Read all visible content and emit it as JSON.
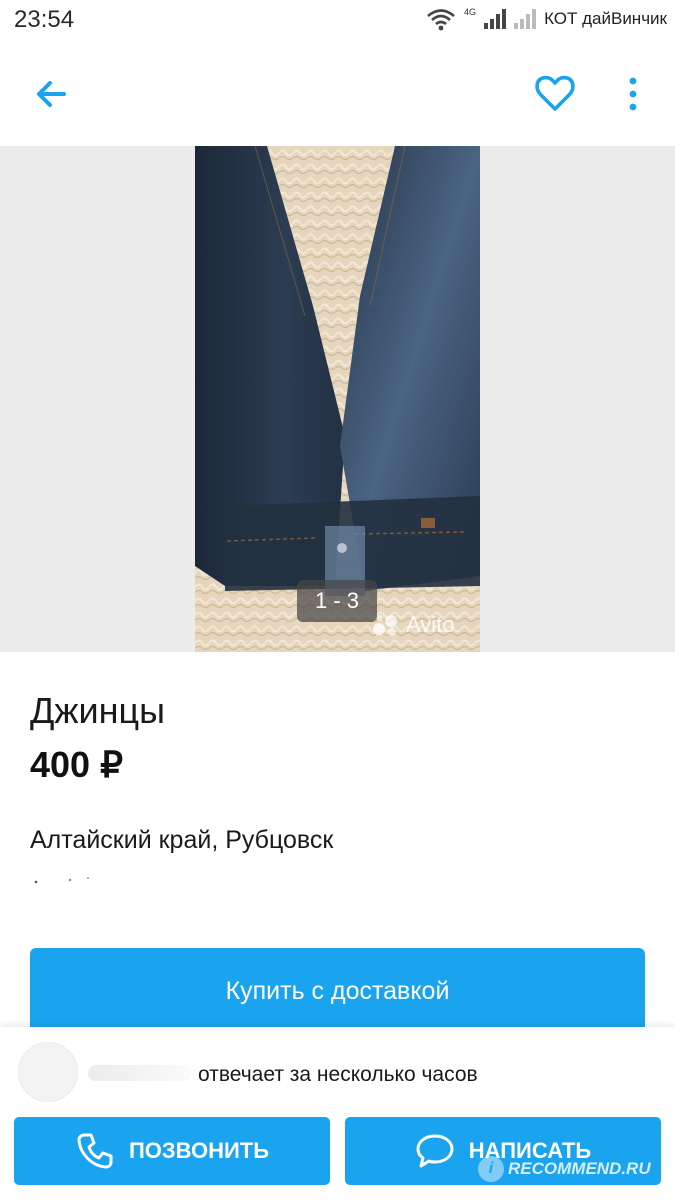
{
  "status_bar": {
    "time": "23:54",
    "network": "4G",
    "carrier": "КОТ дайВинчик"
  },
  "header": {
    "back_icon": "arrow-left-icon",
    "favorite_icon": "heart-outline-icon",
    "more_icon": "more-vertical-icon",
    "accent_color": "#1aa3ee"
  },
  "gallery": {
    "counter": "1 - 3",
    "watermark": "Avito"
  },
  "listing": {
    "title": "Джинцы",
    "price": "400 ₽",
    "location": "Алтайский край, Рубцовск"
  },
  "buy_button": {
    "label": "Купить с доставкой",
    "color": "#1aa3ee"
  },
  "seller": {
    "response_text": "отвечает за несколько часов"
  },
  "actions": {
    "call_label": "ПОЗВОНИТЬ",
    "call_icon": "phone-icon",
    "message_label": "НАПИСАТЬ",
    "message_icon": "chat-bubble-icon"
  },
  "site_watermark": {
    "text": "RECOMMEND.RU",
    "badge": "i"
  }
}
